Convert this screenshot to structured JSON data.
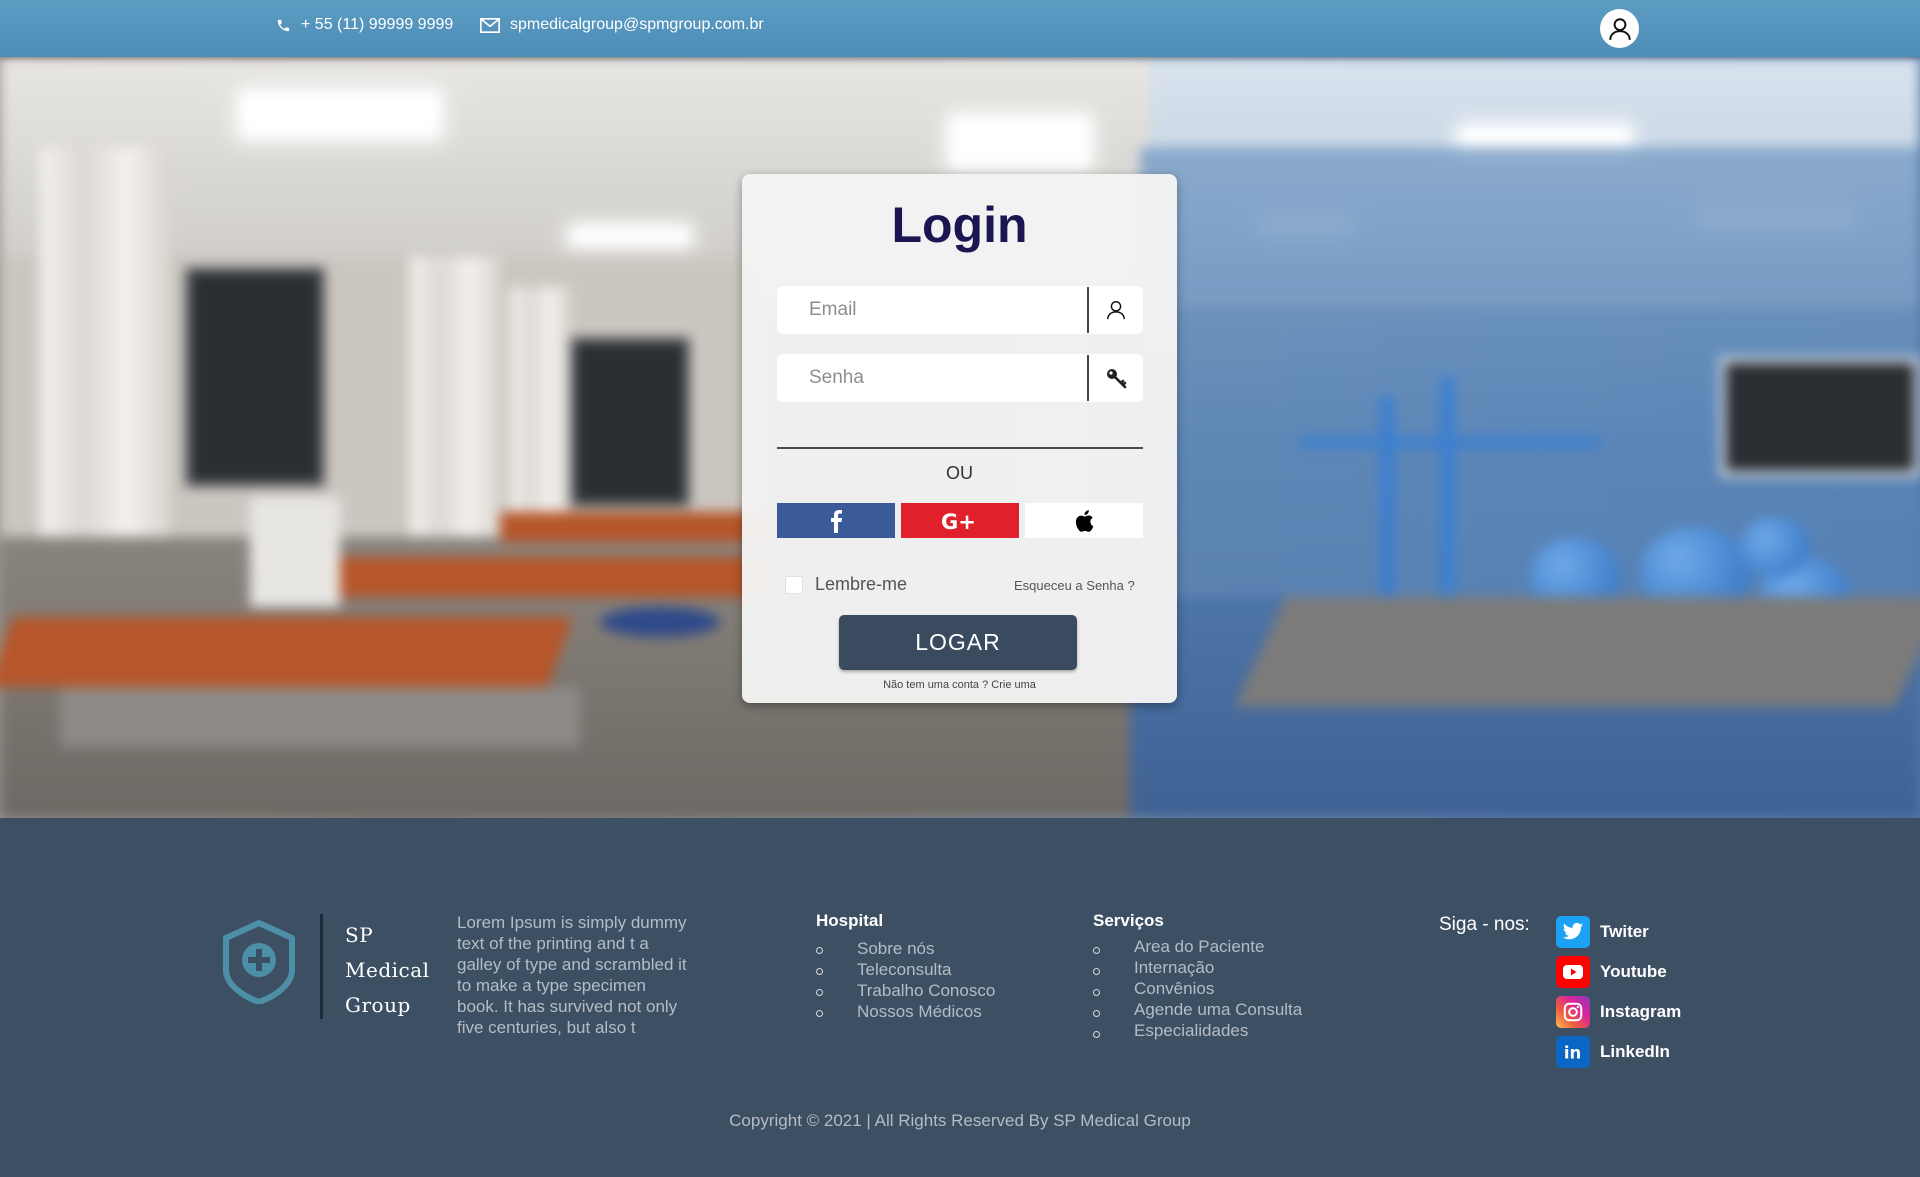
{
  "topbar": {
    "phone": "+ 55 (11) 99999 9999",
    "email": "spmedicalgroup@spmgroup.com.br",
    "user_icon": "user-icon"
  },
  "login": {
    "title": "Login",
    "email_placeholder": "Email",
    "password_placeholder": "Senha",
    "or_label": "OU",
    "social": [
      {
        "name": "facebook",
        "icon": "facebook-icon",
        "color": "#3b5a9a"
      },
      {
        "name": "google-plus",
        "icon": "google-plus-icon",
        "color": "#e0202b"
      },
      {
        "name": "apple",
        "icon": "apple-icon",
        "color": "#ffffff"
      }
    ],
    "remember_label": "Lembre-me",
    "forgot_label": "Esqueceu a Senha ?",
    "submit_label": "LOGAR",
    "signup_label": "Não tem uma conta ? Crie uma"
  },
  "footer": {
    "brand": [
      "SP",
      "Medical",
      "Group"
    ],
    "about": "Lorem Ipsum is simply dummy text of the printing and t a galley of type and scrambled it to make a type specimen book. It has survived not only five centuries, but also t",
    "hospital": {
      "title": "Hospital",
      "items": [
        "Sobre nós",
        "Teleconsulta",
        "Trabalho Conosco",
        "Nossos Médicos"
      ]
    },
    "services": {
      "title": "Serviços",
      "items": [
        "Area do Paciente",
        "Internação",
        "Convênios",
        "Agende uma Consulta",
        "Especialidades"
      ]
    },
    "follow_label": "Siga - nos:",
    "socials": [
      {
        "label": "Twiter",
        "icon": "twitter-icon",
        "color": "#1da1f2"
      },
      {
        "label": "Youtube",
        "icon": "youtube-icon",
        "color": "#ff0000"
      },
      {
        "label": "Instagram",
        "icon": "instagram-icon",
        "color": "#d6249f"
      },
      {
        "label": "LinkedIn",
        "icon": "linkedin-icon",
        "color": "#0a66c2"
      }
    ],
    "copyright": "Copyright © 2021 | All Rights Reserved By SP Medical Group"
  },
  "colors": {
    "topbar": "#5b9cc3",
    "footer": "#3d4f63",
    "title": "#1b1652",
    "button": "#3b4b5f"
  }
}
